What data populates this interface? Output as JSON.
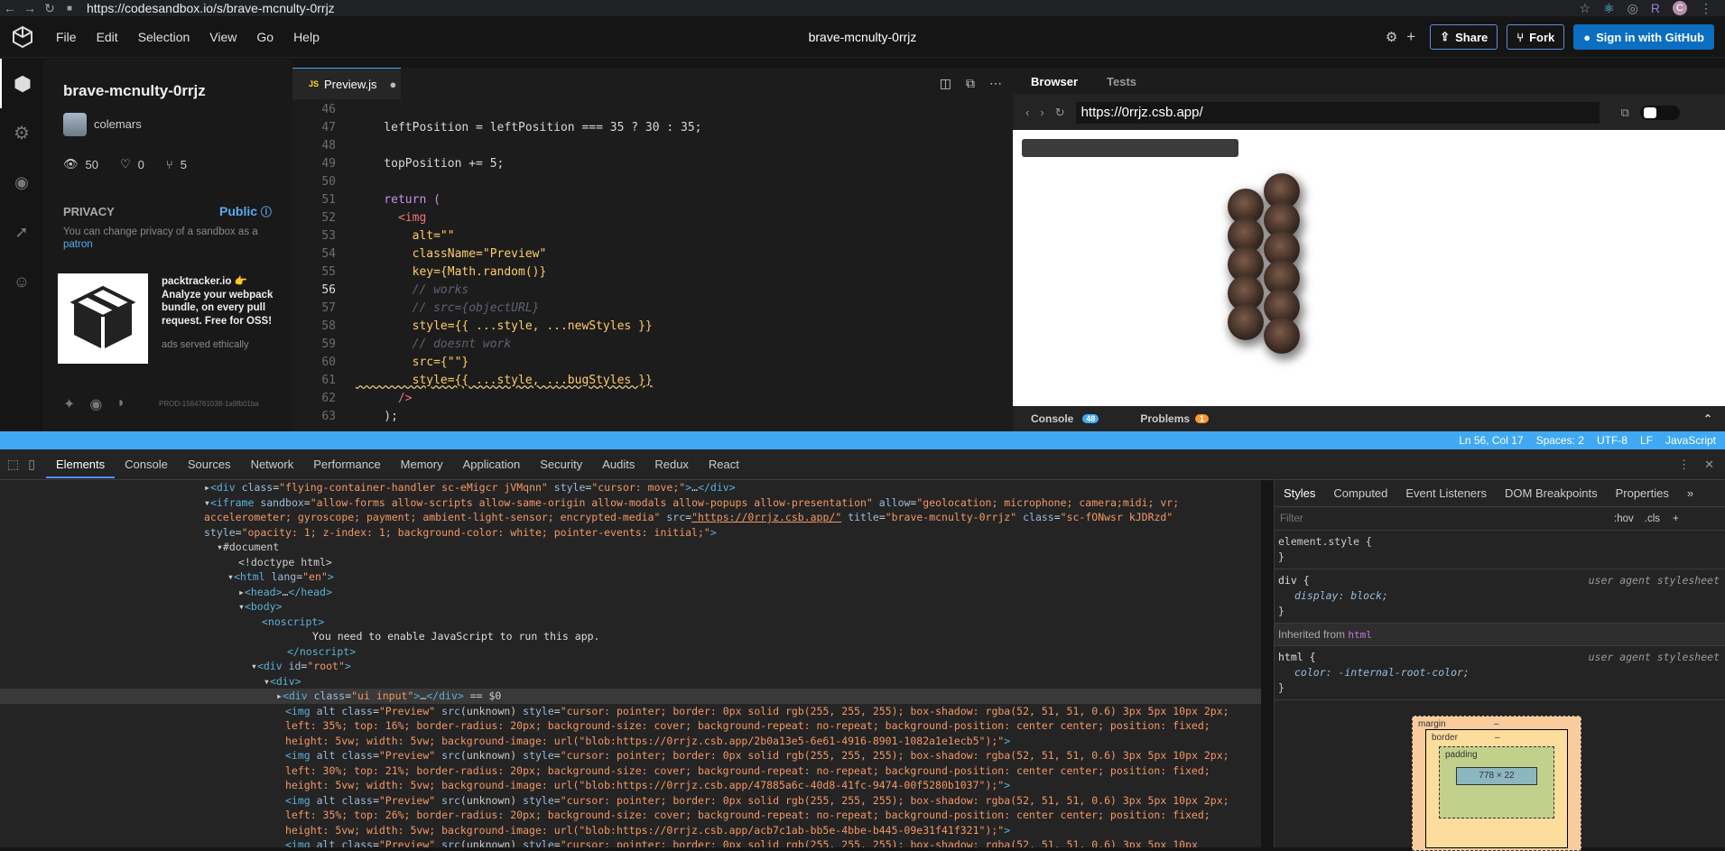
{
  "browser_chrome": {
    "url": "https://codesandbox.io/s/brave-mcnulty-0rrjz"
  },
  "header": {
    "menus": [
      "File",
      "Edit",
      "Selection",
      "View",
      "Go",
      "Help"
    ],
    "title": "brave-mcnulty-0rrjz",
    "share_label": "Share",
    "fork_label": "Fork",
    "signin_label": "Sign in with GitHub"
  },
  "sidebar": {
    "sandbox_name": "brave-mcnulty-0rrjz",
    "author": "colemars",
    "views": "50",
    "likes": "0",
    "forks": "5",
    "privacy_label": "PRIVACY",
    "privacy_value": "Public",
    "privacy_note": "You can change privacy of a sandbox as a",
    "privacy_link": "patron",
    "ad_title": "packtracker.io 👉",
    "ad_body": "Analyze your webpack bundle, on every pull request. Free for OSS!",
    "ad_note": "ads served ethically",
    "build_id": "PROD-1564761038-1a9fb01ba"
  },
  "editor": {
    "tab_name": "Preview.js",
    "tab_badge": "JS",
    "lines": [
      {
        "n": "46",
        "html": ""
      },
      {
        "n": "47",
        "html": "    leftPosition = leftPosition === 35 ? 30 : 35;"
      },
      {
        "n": "48",
        "html": ""
      },
      {
        "n": "49",
        "html": "    topPosition += 5;"
      },
      {
        "n": "50",
        "html": ""
      },
      {
        "n": "51",
        "html": "    return ("
      },
      {
        "n": "52",
        "html": "      <img"
      },
      {
        "n": "53",
        "html": "        alt=\"\""
      },
      {
        "n": "54",
        "html": "        className=\"Preview\""
      },
      {
        "n": "55",
        "html": "        key={Math.random()}"
      },
      {
        "n": "56",
        "html": "        // works"
      },
      {
        "n": "57",
        "html": "        // src={objectURL}"
      },
      {
        "n": "58",
        "html": "        style={{ ...style, ...newStyles }}"
      },
      {
        "n": "59",
        "html": "        // doesnt work"
      },
      {
        "n": "60",
        "html": "        src={\"\"}"
      },
      {
        "n": "61",
        "html": "        style={{ ...style, ...bugStyles }}"
      },
      {
        "n": "62",
        "html": "      />"
      },
      {
        "n": "63",
        "html": "    );"
      }
    ]
  },
  "preview": {
    "tab_browser": "Browser",
    "tab_tests": "Tests",
    "url": "https://0rrjz.csb.app/",
    "console_label": "Console",
    "console_count": "48",
    "problems_label": "Problems",
    "problems_count": "1"
  },
  "status_bar": {
    "position": "Ln 56, Col 17",
    "spaces": "Spaces: 2",
    "encoding": "UTF-8",
    "eol": "LF",
    "language": "JavaScript"
  },
  "devtools": {
    "tabs": [
      "Elements",
      "Console",
      "Sources",
      "Network",
      "Performance",
      "Memory",
      "Application",
      "Security",
      "Audits",
      "Redux",
      "React"
    ],
    "styles_tabs": [
      "Styles",
      "Computed",
      "Event Listeners",
      "DOM Breakpoints",
      "Properties"
    ],
    "filter_placeholder": "Filter",
    "hov": ":hov",
    "cls": ".cls",
    "element_style": "element.style {",
    "rule1_selector": "div {",
    "rule1_source": "user agent stylesheet",
    "rule1_decl": "display: block;",
    "inherited_label": "Inherited from",
    "inherited_tag": "html",
    "rule2_selector": "html {",
    "rule2_source": "user agent stylesheet",
    "rule2_decl": "color: -internal-root-color;",
    "box_margin": "margin",
    "box_border": "border",
    "box_padding": "padding",
    "box_content": "778 × 22",
    "dash": "–"
  }
}
